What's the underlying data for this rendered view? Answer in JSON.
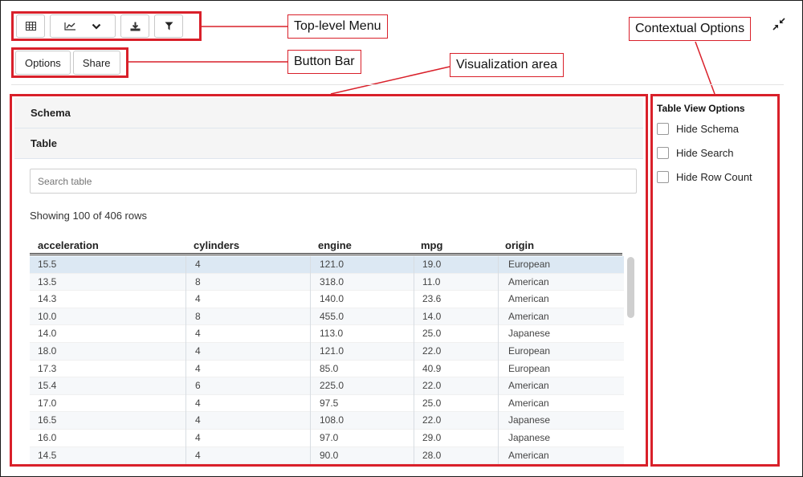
{
  "callouts": {
    "top_menu": "Top-level Menu",
    "button_bar": "Button Bar",
    "viz_area": "Visualization area",
    "contextual": "Contextual Options"
  },
  "toolbar": {
    "icons": [
      "table-icon",
      "line-chart-icon",
      "chevron-down-icon",
      "download-icon",
      "filter-icon"
    ]
  },
  "buttons": {
    "options": "Options",
    "share": "Share"
  },
  "panels": {
    "schema": "Schema",
    "table": "Table"
  },
  "search": {
    "placeholder": "Search table"
  },
  "showing": "Showing 100 of 406 rows",
  "table": {
    "columns": [
      "acceleration",
      "cylinders",
      "engine",
      "mpg",
      "origin"
    ],
    "rows": [
      [
        "15.5",
        "4",
        "121.0",
        "19.0",
        "European"
      ],
      [
        "13.5",
        "8",
        "318.0",
        "11.0",
        "American"
      ],
      [
        "14.3",
        "4",
        "140.0",
        "23.6",
        "American"
      ],
      [
        "10.0",
        "8",
        "455.0",
        "14.0",
        "American"
      ],
      [
        "14.0",
        "4",
        "113.0",
        "25.0",
        "Japanese"
      ],
      [
        "18.0",
        "4",
        "121.0",
        "22.0",
        "European"
      ],
      [
        "17.3",
        "4",
        "85.0",
        "40.9",
        "European"
      ],
      [
        "15.4",
        "6",
        "225.0",
        "22.0",
        "American"
      ],
      [
        "17.0",
        "4",
        "97.5",
        "25.0",
        "American"
      ],
      [
        "16.5",
        "4",
        "108.0",
        "22.0",
        "Japanese"
      ],
      [
        "16.0",
        "4",
        "97.0",
        "29.0",
        "Japanese"
      ],
      [
        "14.5",
        "4",
        "90.0",
        "28.0",
        "American"
      ]
    ]
  },
  "context": {
    "title": "Table View Options",
    "options": [
      "Hide Schema",
      "Hide Search",
      "Hide Row Count"
    ]
  },
  "colors": {
    "annotation": "#d9202a",
    "selected_row": "#dce8f3"
  }
}
